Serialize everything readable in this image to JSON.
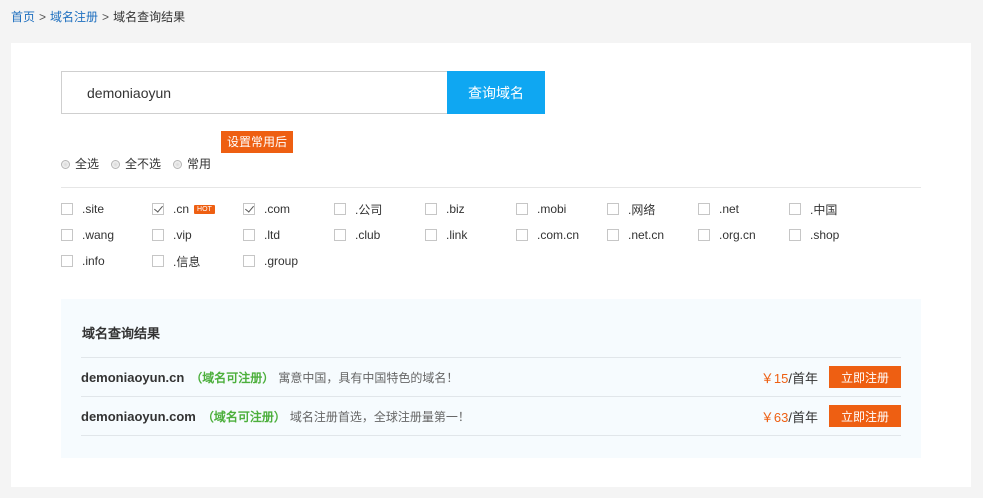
{
  "breadcrumb": {
    "home": "首页",
    "domain_reg": "域名注册",
    "current": "域名查询结果",
    "separator": ">"
  },
  "search": {
    "value": "demoniaoyun",
    "button_label": "查询域名"
  },
  "set_common_label": "设置常用后",
  "radio_options": [
    "全选",
    "全不选",
    "常用"
  ],
  "suffixes": [
    {
      "label": ".site",
      "checked": false
    },
    {
      "label": ".cn",
      "checked": true,
      "badge": "HOT"
    },
    {
      "label": ".com",
      "checked": true
    },
    {
      "label": ".公司",
      "checked": false
    },
    {
      "label": ".biz",
      "checked": false
    },
    {
      "label": ".mobi",
      "checked": false
    },
    {
      "label": ".网络",
      "checked": false
    },
    {
      "label": ".net",
      "checked": false
    },
    {
      "label": ".中国",
      "checked": false
    },
    {
      "label": ".wang",
      "checked": false
    },
    {
      "label": ".vip",
      "checked": false
    },
    {
      "label": ".ltd",
      "checked": false
    },
    {
      "label": ".club",
      "checked": false
    },
    {
      "label": ".link",
      "checked": false
    },
    {
      "label": ".com.cn",
      "checked": false
    },
    {
      "label": ".net.cn",
      "checked": false
    },
    {
      "label": ".org.cn",
      "checked": false
    },
    {
      "label": ".shop",
      "checked": false
    },
    {
      "label": ".info",
      "checked": false
    },
    {
      "label": ".信息",
      "checked": false
    },
    {
      "label": ".group",
      "checked": false
    }
  ],
  "results": {
    "title": "域名查询结果",
    "rows": [
      {
        "domain": "demoniaoyun.cn",
        "status": "（域名可注册）",
        "desc": "寓意中国，具有中国特色的域名！",
        "price": "￥15",
        "unit": "/首年",
        "button": "立即注册"
      },
      {
        "domain": "demoniaoyun.com",
        "status": "（域名可注册）",
        "desc": "域名注册首选，全球注册量第一！",
        "price": "￥63",
        "unit": "/首年",
        "button": "立即注册"
      }
    ]
  },
  "colors": {
    "link_blue": "#1e6fbf",
    "search_button": "#0fa7f2",
    "accent_orange": "#ee5f12",
    "available_green": "#4caf3c"
  }
}
